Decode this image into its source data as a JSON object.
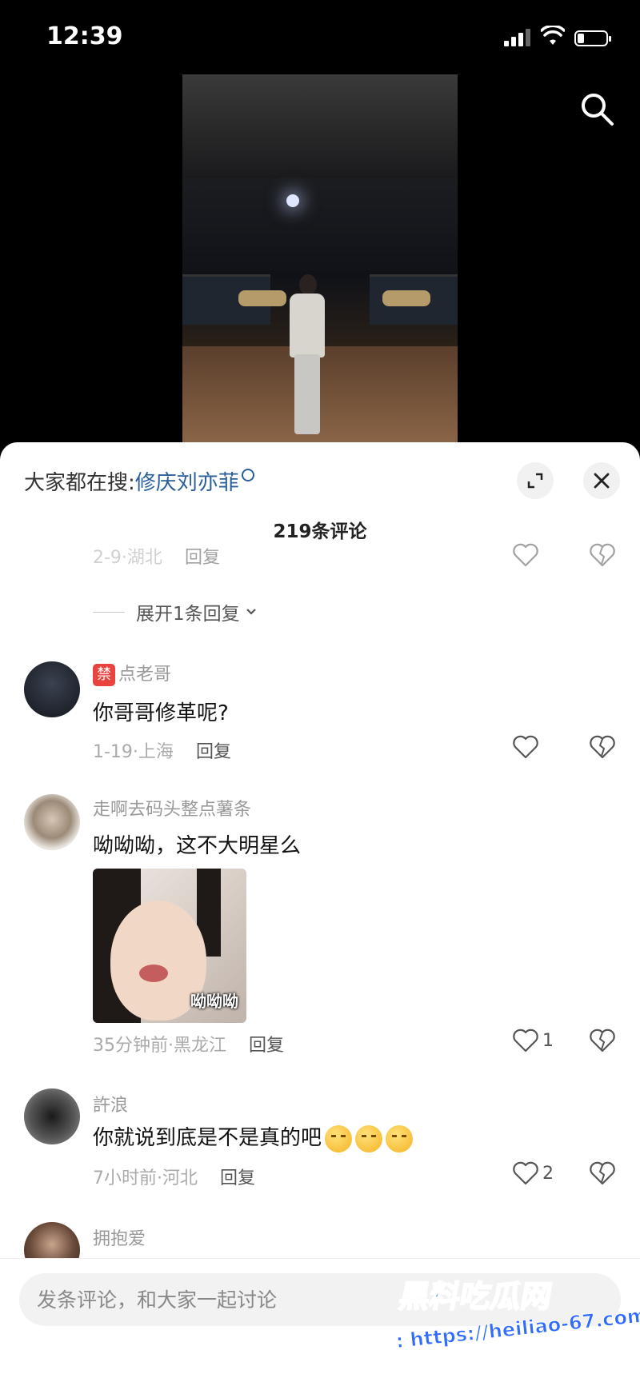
{
  "status_bar": {
    "time": "12:39"
  },
  "trending": {
    "prefix": "大家都在搜:",
    "keyword": "修庆刘亦菲"
  },
  "comment_count": "219条评论",
  "partial_comment": {
    "date_location": "2-9·湖北",
    "reply_label": "回复"
  },
  "expand_replies": "展开1条回复",
  "comments": [
    {
      "badge": "禁",
      "username": "点老哥",
      "text": "你哥哥修革呢?",
      "date_location": "1-19·上海",
      "reply_label": "回复",
      "likes": ""
    },
    {
      "username": "走啊去码头整点薯条",
      "text": "呦呦呦，这不大明星么",
      "sticker_caption": "呦呦呦",
      "date_location": "35分钟前·黑龙江",
      "reply_label": "回复",
      "likes": "1"
    },
    {
      "username": "許浪",
      "text": "你就说到底是不是真的吧",
      "emojis": [
        "smirk-emoji",
        "smirk-emoji",
        "smirk-emoji"
      ],
      "date_location": "7小时前·河北",
      "reply_label": "回复",
      "likes": "2"
    },
    {
      "username": "拥抱爱"
    }
  ],
  "input": {
    "placeholder": "发条评论，和大家一起讨论"
  },
  "watermark": {
    "title": "黑料吃瓜网",
    "url": "看完整版: https://heiliao-67.com"
  },
  "icons": [
    "search-icon",
    "expand-icon",
    "close-icon",
    "heart-icon",
    "broken-heart-icon",
    "chevron-down-icon",
    "wifi-icon",
    "battery-icon"
  ]
}
